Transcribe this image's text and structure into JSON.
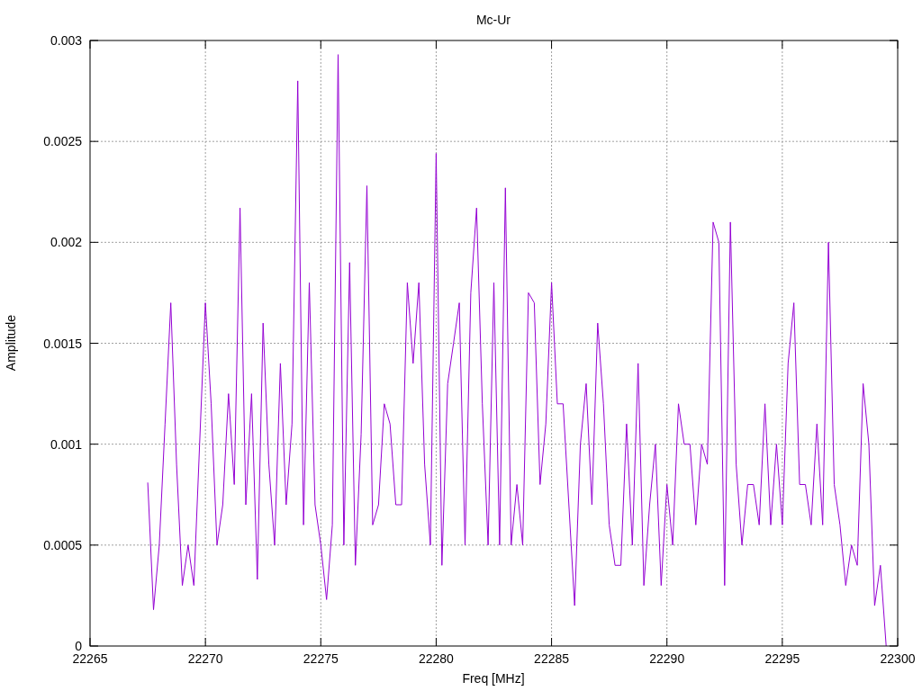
{
  "chart": {
    "chart_data": {
      "type": "line",
      "title": "Mc-Ur",
      "xlabel": "Freq [MHz]",
      "ylabel": "Amplitude",
      "grid": true,
      "xlim": [
        22265,
        22300
      ],
      "ylim": [
        0,
        0.003
      ],
      "xticks": [
        22265,
        22270,
        22275,
        22280,
        22285,
        22290,
        22295,
        22300
      ],
      "yticks": [
        {
          "value": 0,
          "label": "0"
        },
        {
          "value": 0.0005,
          "label": "0.0005"
        },
        {
          "value": 0.001,
          "label": "0.001"
        },
        {
          "value": 0.0015,
          "label": "0.0015"
        },
        {
          "value": 0.002,
          "label": "0.002"
        },
        {
          "value": 0.0025,
          "label": "0.0025"
        },
        {
          "value": 0.003,
          "label": "0.003"
        }
      ],
      "x": [
        22267.5,
        22267.75,
        22268,
        22268.25,
        22268.5,
        22268.75,
        22269,
        22269.25,
        22269.5,
        22269.75,
        22270,
        22270.25,
        22270.5,
        22270.75,
        22271,
        22271.25,
        22271.5,
        22271.75,
        22272,
        22272.25,
        22272.5,
        22272.75,
        22273,
        22273.25,
        22273.5,
        22273.75,
        22274,
        22274.25,
        22274.5,
        22274.75,
        22275,
        22275.25,
        22275.5,
        22275.75,
        22276,
        22276.25,
        22276.5,
        22276.75,
        22277,
        22277.25,
        22277.5,
        22277.75,
        22278,
        22278.25,
        22278.5,
        22278.75,
        22279,
        22279.25,
        22279.5,
        22279.75,
        22280,
        22280.25,
        22280.5,
        22280.75,
        22281,
        22281.25,
        22281.5,
        22281.75,
        22282,
        22282.25,
        22282.5,
        22282.75,
        22283,
        22283.25,
        22283.5,
        22283.75,
        22284,
        22284.25,
        22284.5,
        22284.75,
        22285,
        22285.25,
        22285.5,
        22285.75,
        22286,
        22286.25,
        22286.5,
        22286.75,
        22287,
        22287.25,
        22287.5,
        22287.75,
        22288,
        22288.25,
        22288.5,
        22288.75,
        22289,
        22289.25,
        22289.5,
        22289.75,
        22290,
        22290.25,
        22290.5,
        22290.75,
        22291,
        22291.25,
        22291.5,
        22291.75,
        22292,
        22292.25,
        22292.5,
        22292.75,
        22293,
        22293.25,
        22293.5,
        22293.75,
        22294,
        22294.25,
        22294.5,
        22294.75,
        22295,
        22295.25,
        22295.5,
        22295.75,
        22296,
        22296.25,
        22296.5,
        22296.75,
        22297,
        22297.25,
        22297.5,
        22297.75,
        22298,
        22298.25,
        22298.5,
        22298.75,
        22299,
        22299.25,
        22299.5
      ],
      "series": [
        {
          "color": "#9400d3",
          "values": [
            0.00081,
            0.00018,
            0.0005,
            0.0011,
            0.0017,
            0.0009,
            0.0003,
            0.0005,
            0.0003,
            0.001,
            0.0017,
            0.0012,
            0.0005,
            0.0007,
            0.00125,
            0.0008,
            0.00217,
            0.0007,
            0.00125,
            0.00033,
            0.0016,
            0.0009,
            0.0005,
            0.0014,
            0.0007,
            0.0011,
            0.0028,
            0.0006,
            0.0018,
            0.0007,
            0.0005,
            0.00023,
            0.0006,
            0.00293,
            0.0005,
            0.0019,
            0.0004,
            0.00105,
            0.00228,
            0.0006,
            0.0007,
            0.0012,
            0.0011,
            0.0007,
            0.0007,
            0.0018,
            0.0014,
            0.0018,
            0.0009,
            0.0005,
            0.00244,
            0.0004,
            0.0013,
            0.0015,
            0.0017,
            0.0005,
            0.00175,
            0.00217,
            0.0012,
            0.0005,
            0.0018,
            0.0005,
            0.00227,
            0.0005,
            0.0008,
            0.0005,
            0.00175,
            0.0017,
            0.0008,
            0.0011,
            0.0018,
            0.0012,
            0.0012,
            0.0007,
            0.0002,
            0.001,
            0.0013,
            0.0007,
            0.0016,
            0.0012,
            0.0006,
            0.0004,
            0.0004,
            0.0011,
            0.0005,
            0.0014,
            0.0003,
            0.0007,
            0.001,
            0.0003,
            0.0008,
            0.0005,
            0.0012,
            0.001,
            0.001,
            0.0006,
            0.001,
            0.0009,
            0.0021,
            0.002,
            0.0003,
            0.0021,
            0.0009,
            0.0005,
            0.0008,
            0.0008,
            0.0006,
            0.0012,
            0.0006,
            0.001,
            0.0006,
            0.0014,
            0.0017,
            0.0008,
            0.0008,
            0.0006,
            0.0011,
            0.0006,
            0.002,
            0.0008,
            0.0006,
            0.0003,
            0.0005,
            0.0004,
            0.0013,
            0.001,
            0.0002,
            0.0004,
            0
          ]
        }
      ]
    }
  }
}
